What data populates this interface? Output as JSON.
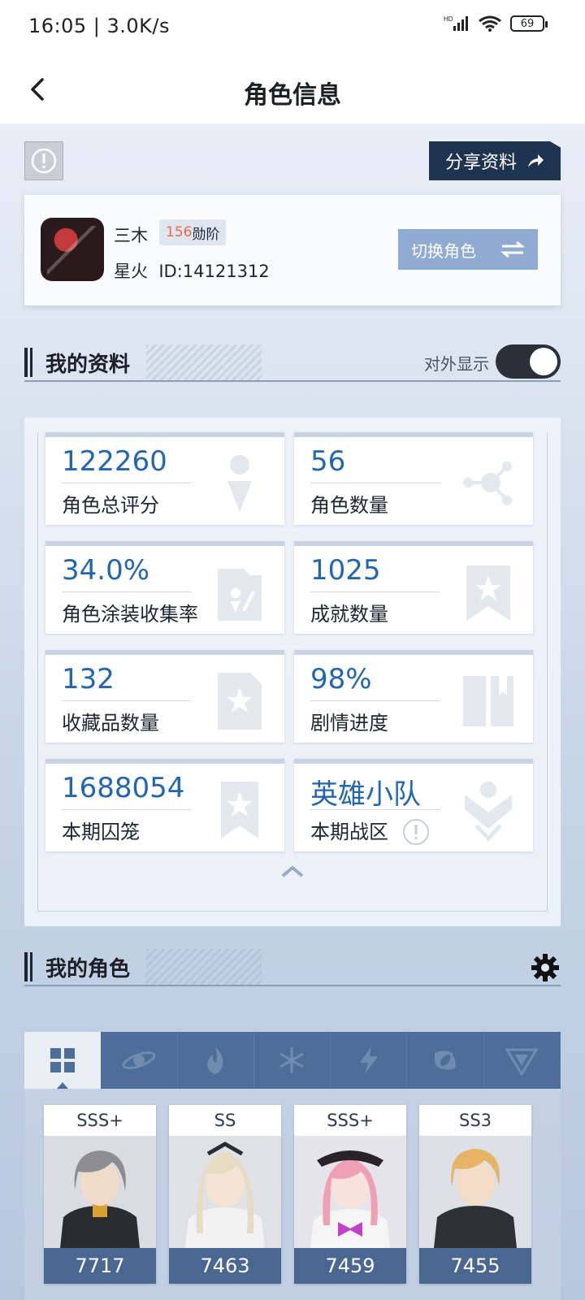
{
  "status_bar": {
    "time": "16:05 | 3.0K/s",
    "battery": "69"
  },
  "header": {
    "title": "角色信息"
  },
  "share_label": "分享资料",
  "profile": {
    "name": "三木",
    "rank_num": "156",
    "rank_suffix": "勋阶",
    "server": "星火",
    "id": "ID:14121312",
    "switch_label": "切换角色"
  },
  "my_data": {
    "title": "我的资料",
    "toggle_label": "对外显示",
    "toggle_on": true,
    "stats": [
      {
        "value": "122260",
        "label": "角色总评分",
        "icon": "person-icon"
      },
      {
        "value": "56",
        "label": "角色数量",
        "icon": "network-icon"
      },
      {
        "value": "34.0%",
        "label": "角色涂装收集率",
        "icon": "coating-icon"
      },
      {
        "value": "1025",
        "label": "成就数量",
        "icon": "star-bookmark-icon"
      },
      {
        "value": "132",
        "label": "收藏品数量",
        "icon": "star-document-icon"
      },
      {
        "value": "98%",
        "label": "剧情进度",
        "icon": "book-icon"
      },
      {
        "value": "1688054",
        "label": "本期囚笼",
        "icon": "star-banner-icon"
      },
      {
        "value": "英雄小队",
        "label": "本期战区",
        "icon": "warzone-icon"
      }
    ]
  },
  "my_chars": {
    "title": "我的角色",
    "tabs": [
      "all-icon",
      "class-icon",
      "fire-icon",
      "ice-icon",
      "lightning-icon",
      "dark-icon",
      "physical-icon"
    ],
    "characters": [
      {
        "rank": "SSS+",
        "power": "7717",
        "hair": "#8c8c91"
      },
      {
        "rank": "SS",
        "power": "7463",
        "hair": "#e6dcc3"
      },
      {
        "rank": "SSS+",
        "power": "7459",
        "hair": "#f0a0b4"
      },
      {
        "rank": "SS3",
        "power": "7455",
        "hair": "#e6b464"
      }
    ]
  },
  "colors": {
    "accent_blue": "#2366b0",
    "share_bg": "#1e3350",
    "switch_bg": "#8fabd1",
    "tab_bg": "#4d6e98",
    "rank_orange": "#e86a4a"
  }
}
